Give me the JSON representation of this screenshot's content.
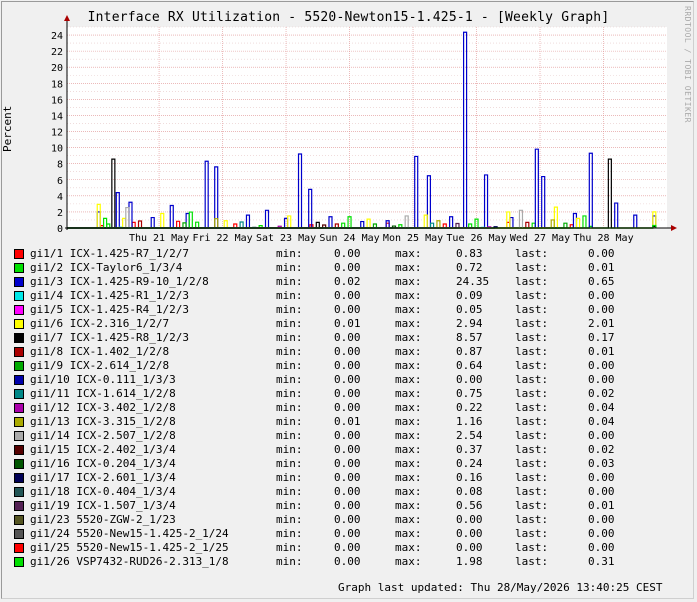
{
  "title": "Interface RX Utilization - 5520-Newton15-1.425-1 - [Weekly Graph]",
  "watermark": "RRDTOOL / TOBI OETIKER",
  "footer": "Graph last updated: Thu 28/May/2026 13:40:25 CEST",
  "labels": {
    "min": "min:",
    "max": "max:",
    "last": "last:"
  },
  "chart_data": {
    "type": "line",
    "ylabel": "Percent",
    "ylim": [
      0,
      25
    ],
    "yticks": [
      0,
      2,
      4,
      6,
      8,
      10,
      12,
      14,
      16,
      18,
      20,
      22,
      24
    ],
    "grid": true,
    "xlim_days": [
      0,
      8
    ],
    "xticks": [
      {
        "label": "Thu 21 May",
        "day": 1
      },
      {
        "label": "Fri 22 May",
        "day": 2
      },
      {
        "label": "Sat 23 May",
        "day": 3
      },
      {
        "label": "Sun 24 May",
        "day": 4
      },
      {
        "label": "Mon 25 May",
        "day": 5
      },
      {
        "label": "Tue 26 May",
        "day": 6
      },
      {
        "label": "Wed 27 May",
        "day": 7
      },
      {
        "label": "Thu 28 May",
        "day": 8
      }
    ],
    "legend_position": "bottom",
    "series": [
      {
        "name": "gi1/1 ICX-1.425-R7_1/2/7",
        "color": "#ff0000",
        "min": "0.00",
        "max": "0.83",
        "last": "0.00",
        "points": [
          [
            0.1,
            0.3
          ],
          [
            0.6,
            0.7
          ],
          [
            1.3,
            0.83
          ],
          [
            2.2,
            0.5
          ],
          [
            3.4,
            0.4
          ],
          [
            4.6,
            0.6
          ],
          [
            5.5,
            0.5
          ],
          [
            6.5,
            0.7
          ],
          [
            7.5,
            0.4
          ]
        ]
      },
      {
        "name": "gi1/2 ICX-Taylor6_1/3/4",
        "color": "#00e000",
        "min": "0.00",
        "max": "0.72",
        "last": "0.01",
        "points": [
          [
            0.2,
            0.5
          ],
          [
            1.6,
            0.72
          ],
          [
            2.6,
            0.3
          ],
          [
            3.9,
            0.6
          ],
          [
            4.8,
            0.4
          ],
          [
            5.9,
            0.5
          ],
          [
            6.9,
            0.6
          ],
          [
            7.8,
            0.2
          ]
        ]
      },
      {
        "name": "gi1/3 ICX-1.425-R9-10_1/2/8",
        "color": "#0000cc",
        "min": "0.02",
        "max": "24.35",
        "last": "0.65",
        "points": [
          [
            0.05,
            2.0
          ],
          [
            0.35,
            4.4
          ],
          [
            0.55,
            3.2
          ],
          [
            0.9,
            1.3
          ],
          [
            1.2,
            2.8
          ],
          [
            1.45,
            1.8
          ],
          [
            1.75,
            8.3
          ],
          [
            1.9,
            7.6
          ],
          [
            2.4,
            1.6
          ],
          [
            2.7,
            2.2
          ],
          [
            3.0,
            1.2
          ],
          [
            3.22,
            9.2
          ],
          [
            3.38,
            4.8
          ],
          [
            3.7,
            1.4
          ],
          [
            4.2,
            0.8
          ],
          [
            4.6,
            0.9
          ],
          [
            5.05,
            8.9
          ],
          [
            5.25,
            6.5
          ],
          [
            5.6,
            1.4
          ],
          [
            5.82,
            24.35
          ],
          [
            6.15,
            6.6
          ],
          [
            6.55,
            1.3
          ],
          [
            6.95,
            9.8
          ],
          [
            7.05,
            6.4
          ],
          [
            7.55,
            1.8
          ],
          [
            7.8,
            9.3
          ],
          [
            8.2,
            3.1
          ],
          [
            8.5,
            1.6
          ],
          [
            8.8,
            1.5
          ]
        ]
      },
      {
        "name": "gi1/4 ICX-1.425-R1_1/2/3",
        "color": "#00e8e8",
        "min": "0.00",
        "max": "0.09",
        "last": "0.00",
        "points": [
          [
            0.4,
            0.09
          ],
          [
            3.3,
            0.05
          ],
          [
            6.1,
            0.08
          ]
        ]
      },
      {
        "name": "gi1/5 ICX-1.425-R4_1/2/3",
        "color": "#ff00ff",
        "min": "0.00",
        "max": "0.05",
        "last": "0.00",
        "points": [
          [
            1.1,
            0.05
          ],
          [
            4.1,
            0.04
          ],
          [
            7.1,
            0.05
          ]
        ]
      },
      {
        "name": "gi1/6 ICX-2.316_1/2/7",
        "color": "#ffff00",
        "min": "0.01",
        "max": "2.94",
        "last": "2.01",
        "points": [
          [
            0.05,
            2.94
          ],
          [
            0.45,
            1.2
          ],
          [
            1.05,
            1.8
          ],
          [
            2.05,
            0.9
          ],
          [
            3.05,
            1.5
          ],
          [
            4.3,
            1.1
          ],
          [
            5.2,
            1.6
          ],
          [
            6.5,
            2.0
          ],
          [
            7.25,
            2.6
          ],
          [
            7.6,
            1.2
          ],
          [
            8.8,
            2.01
          ]
        ]
      },
      {
        "name": "gi1/7 ICX-1.425-R8_1/2/3",
        "color": "#000000",
        "min": "0.00",
        "max": "8.57",
        "last": "0.17",
        "points": [
          [
            0.28,
            8.57
          ],
          [
            3.5,
            0.7
          ],
          [
            8.1,
            8.57
          ],
          [
            8.8,
            0.17
          ]
        ]
      },
      {
        "name": "gi1/8 ICX-1.402_1/2/8",
        "color": "#aa0000",
        "min": "0.00",
        "max": "0.87",
        "last": "0.01",
        "points": [
          [
            0.7,
            0.87
          ],
          [
            3.8,
            0.5
          ],
          [
            6.8,
            0.7
          ]
        ]
      },
      {
        "name": "gi1/9 ICX-2.614_1/2/8",
        "color": "#00aa00",
        "min": "0.00",
        "max": "0.64",
        "last": "0.00",
        "points": [
          [
            1.4,
            0.64
          ],
          [
            4.4,
            0.5
          ],
          [
            7.4,
            0.6
          ]
        ]
      },
      {
        "name": "gi1/10 ICX-0.111_1/3/3",
        "color": "#0000aa",
        "min": "0.00",
        "max": "0.00",
        "last": "0.00",
        "points": []
      },
      {
        "name": "gi1/11 ICX-1.614_1/2/8",
        "color": "#008888",
        "min": "0.00",
        "max": "0.75",
        "last": "0.02",
        "points": [
          [
            2.3,
            0.75
          ],
          [
            5.3,
            0.6
          ]
        ]
      },
      {
        "name": "gi1/12 ICX-3.402_1/2/8",
        "color": "#aa00aa",
        "min": "0.00",
        "max": "0.22",
        "last": "0.04",
        "points": [
          [
            2.9,
            0.22
          ],
          [
            6.2,
            0.15
          ]
        ]
      },
      {
        "name": "gi1/13 ICX-3.315_1/2/8",
        "color": "#aaaa00",
        "min": "0.01",
        "max": "1.16",
        "last": "0.04",
        "points": [
          [
            1.9,
            1.16
          ],
          [
            5.4,
            0.9
          ],
          [
            7.2,
            1.0
          ]
        ]
      },
      {
        "name": "gi1/14 ICX-2.507_1/2/8",
        "color": "#aaaaaa",
        "min": "0.00",
        "max": "2.54",
        "last": "0.00",
        "points": [
          [
            0.5,
            2.54
          ],
          [
            4.9,
            1.5
          ],
          [
            6.7,
            2.2
          ]
        ]
      },
      {
        "name": "gi1/15 ICX-2.402_1/3/4",
        "color": "#550000",
        "min": "0.00",
        "max": "0.37",
        "last": "0.02",
        "points": [
          [
            3.6,
            0.37
          ]
        ]
      },
      {
        "name": "gi1/16 ICX-0.204_1/3/4",
        "color": "#005500",
        "min": "0.00",
        "max": "0.24",
        "last": "0.03",
        "points": [
          [
            4.7,
            0.24
          ]
        ]
      },
      {
        "name": "gi1/17 ICX-2.601_1/3/4",
        "color": "#000055",
        "min": "0.00",
        "max": "0.16",
        "last": "0.00",
        "points": [
          [
            6.3,
            0.16
          ]
        ]
      },
      {
        "name": "gi1/18 ICX-0.404_1/3/4",
        "color": "#225555",
        "min": "0.00",
        "max": "0.08",
        "last": "0.00",
        "points": [
          [
            2.5,
            0.08
          ]
        ]
      },
      {
        "name": "gi1/19 ICX-1.507_1/3/4",
        "color": "#552255",
        "min": "0.00",
        "max": "0.56",
        "last": "0.01",
        "points": [
          [
            5.7,
            0.56
          ]
        ]
      },
      {
        "name": "gi1/23 5520-ZGW-2_1/23",
        "color": "#555522",
        "min": "0.00",
        "max": "0.00",
        "last": "0.00",
        "points": []
      },
      {
        "name": "gi1/24 5520-New15-1.425-2_1/24",
        "color": "#555555",
        "min": "0.00",
        "max": "0.00",
        "last": "0.00",
        "points": []
      },
      {
        "name": "gi1/25 5520-New15-1.425-2_1/25",
        "color": "#ff0000",
        "min": "0.00",
        "max": "0.00",
        "last": "0.00",
        "points": []
      },
      {
        "name": "gi1/26 VSP7432-RUD26-2.313_1/8",
        "color": "#00e000",
        "min": "0.00",
        "max": "1.98",
        "last": "0.31",
        "points": [
          [
            0.15,
            1.2
          ],
          [
            1.5,
            1.98
          ],
          [
            4.0,
            1.4
          ],
          [
            6.0,
            1.1
          ],
          [
            7.7,
            1.5
          ],
          [
            8.8,
            0.31
          ]
        ]
      }
    ]
  }
}
